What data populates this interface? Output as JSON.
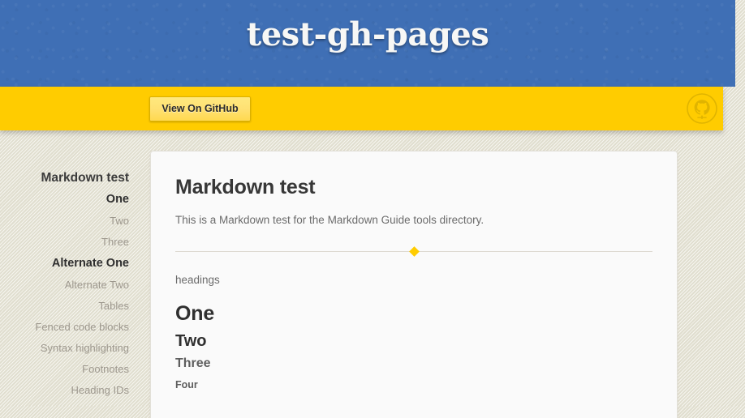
{
  "header": {
    "title": "test-gh-pages",
    "background_color": "#3f6fb5"
  },
  "banner": {
    "background_color": "#ffcc00",
    "github_button_label": "View On GitHub",
    "octocat_icon": "octocat-icon"
  },
  "sidebar": {
    "items": [
      {
        "label": "Markdown test",
        "level": 1
      },
      {
        "label": "One",
        "level": 2
      },
      {
        "label": "Two",
        "level": 3
      },
      {
        "label": "Three",
        "level": 3
      },
      {
        "label": "Alternate One",
        "level": 2
      },
      {
        "label": "Alternate Two",
        "level": 3
      },
      {
        "label": "Tables",
        "level": 3
      },
      {
        "label": "Fenced code blocks",
        "level": 3
      },
      {
        "label": "Syntax highlighting",
        "level": 3
      },
      {
        "label": "Footnotes",
        "level": 3
      },
      {
        "label": "Heading IDs",
        "level": 3
      }
    ]
  },
  "main": {
    "title": "Markdown test",
    "intro": "This is a Markdown test for the Markdown Guide tools directory.",
    "divider_color": "#ffcc00",
    "section_label": "headings",
    "heading_one": "One",
    "heading_two": "Two",
    "heading_three": "Three",
    "heading_four": "Four"
  }
}
